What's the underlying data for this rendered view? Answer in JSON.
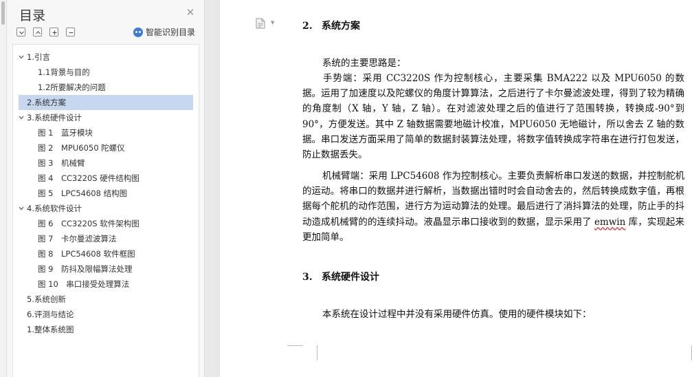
{
  "toc": {
    "title": "目录",
    "smart_label": "智能识别目录",
    "items": [
      {
        "label": "1.引言",
        "level": 0,
        "caret": true,
        "selected": false
      },
      {
        "label": "1.1背景与目的",
        "level": 1,
        "caret": false,
        "selected": false
      },
      {
        "label": "1.2所要解决的问题",
        "level": 1,
        "caret": false,
        "selected": false
      },
      {
        "label": "2.系统方案",
        "level": 0,
        "caret": false,
        "selected": true
      },
      {
        "label": "3.系统硬件设计",
        "level": 0,
        "caret": true,
        "selected": false
      },
      {
        "label": "图 1　蓝牙模块",
        "level": 1,
        "caret": false,
        "selected": false
      },
      {
        "label": "图 2　MPU6050 陀螺仪",
        "level": 1,
        "caret": false,
        "selected": false
      },
      {
        "label": "图 3　机械臂",
        "level": 1,
        "caret": false,
        "selected": false
      },
      {
        "label": "图 4　CC3220S 硬件结构图",
        "level": 1,
        "caret": false,
        "selected": false
      },
      {
        "label": "图 5　LPC54608  结构图",
        "level": 1,
        "caret": false,
        "selected": false
      },
      {
        "label": "4.系统软件设计",
        "level": 0,
        "caret": true,
        "selected": false
      },
      {
        "label": "图 6　CC3220S 软件架构图",
        "level": 1,
        "caret": false,
        "selected": false
      },
      {
        "label": "图 7　卡尔曼滤波算法",
        "level": 1,
        "caret": false,
        "selected": false
      },
      {
        "label": "图 8　LPC54608 软件框图",
        "level": 1,
        "caret": false,
        "selected": false
      },
      {
        "label": "图 9　防抖及限幅算法处理",
        "level": 1,
        "caret": false,
        "selected": false
      },
      {
        "label": "图 10　串口接受处理算法",
        "level": 1,
        "caret": false,
        "selected": false
      },
      {
        "label": "5.系统创新",
        "level": 0,
        "caret": false,
        "selected": false
      },
      {
        "label": "6.评测与结论",
        "level": 0,
        "caret": false,
        "selected": false
      },
      {
        "label": "1.整体系统图",
        "level": 0,
        "caret": false,
        "selected": false
      }
    ]
  },
  "doc": {
    "h2_num": "2.",
    "h2_text": "系统方案",
    "p_intro": "系统的主要思路是：",
    "p_hand": "手势端：采用 CC3220S 作为控制核心，主要采集 BMA222 以及 MPU6050 的数据。运用了加速度以及陀螺仪的角度计算算法，之后进行了卡尔曼滤波处理，得到了较为精确的角度制（X 轴，Y 轴，Z 轴）。在对滤波处理之后的值进行了范围转换，转换成-90°到 90°，方便发送。其中 Z 轴数据需要地磁计校准，MPU6050 无地磁计，所以舍去 Z 轴的数据。串口发送方面采用了简单的数据封装算法处理，将数字值转换成字符串在进行打包发送，防止数据丢失。",
    "p_arm_1": "机械臂端：采用 LPC54608 作为控制核心。主要负责解析串口发送的数据，并控制舵机的运动。将串口的数据并进行解析，当数据出错时时会自动舍去的，然后转换成数字值，再根据每个舵机的动作范围，进行方为运动算法的处理。最后进行了消抖算法的处理，防止手的抖动造成机械臂的的连续抖动。液晶显示串口接收到的数据，显示采用了 ",
    "p_arm_u": "emwin",
    "p_arm_2": " 库，实现起来更加简单。",
    "h3_num": "3.",
    "h3_text": "系统硬件设计",
    "p_hw": "本系统在设计过程中并没有采用硬件仿真。使用的硬件模块如下："
  }
}
